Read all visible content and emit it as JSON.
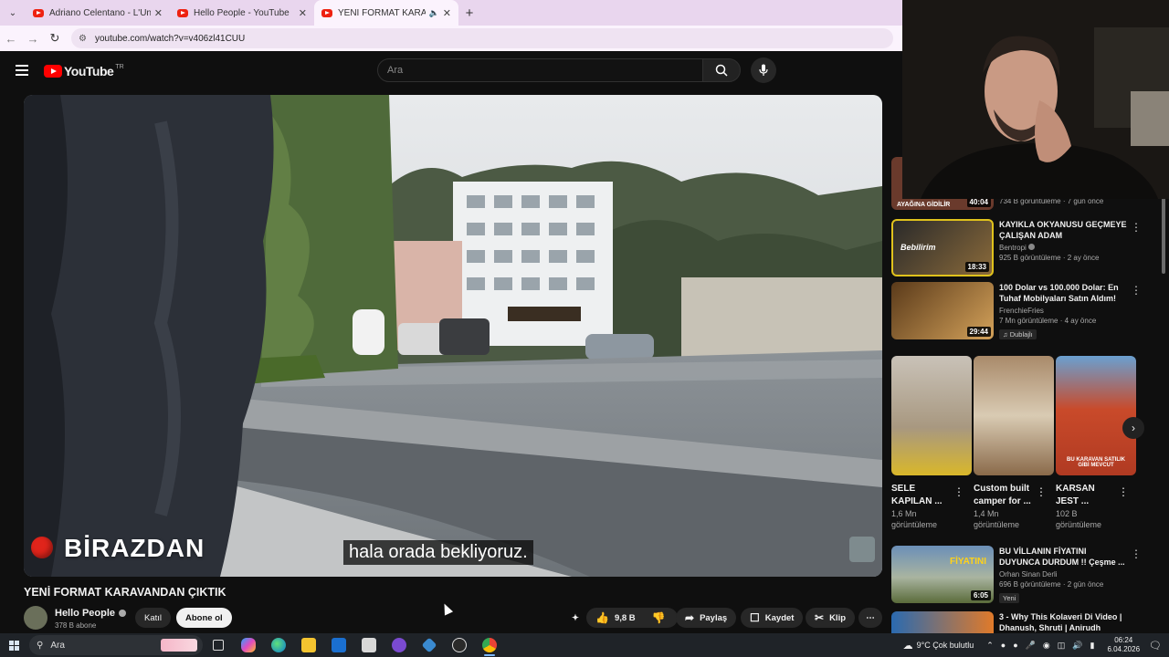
{
  "browser": {
    "tabs": [
      {
        "title": "Adriano Celentano - L'Unica Ch",
        "active": false
      },
      {
        "title": "Hello People - YouTube",
        "active": false
      },
      {
        "title": "YENİ FORMAT KARAVANDA",
        "active": true
      }
    ],
    "url": "youtube.com/watch?v=v406zl41CUU"
  },
  "yt": {
    "country": "TR",
    "logo": "YouTube",
    "search_placeholder": "Ara"
  },
  "video": {
    "overlay_text": "BİRAZDAN",
    "subtitle": "hala orada bekliyoruz.",
    "title": "YENİ FORMAT KARAVANDAN ÇIKTIK",
    "channel": "Hello People",
    "subscribers": "378 B abone",
    "join_label": "Katıl",
    "subscribe_label": "Abone ol",
    "likes": "9,8 B",
    "share_label": "Paylaş",
    "save_label": "Kaydet",
    "clip_label": "Klip"
  },
  "sidebar": {
    "top_partial": {
      "thumb_text": "AYAĞINA GİDİLİR",
      "duration": "40:04",
      "meta": "734 B görüntüleme · 7 gün önce"
    },
    "items": [
      {
        "title": "KAYIKLA OKYANUSU GEÇMEYE ÇALIŞAN ADAM",
        "channel": "Bentropi",
        "meta": "925 B görüntüleme · 2 ay önce",
        "duration": "18:33",
        "thumb_text": "Bebilirim"
      },
      {
        "title": "100 Dolar vs 100.000 Dolar: En Tuhaf Mobilyaları Satın Aldım!",
        "channel": "FrenchieFries",
        "meta": "7 Mn görüntüleme · 4 ay önce",
        "duration": "29:44",
        "badge": "Dublajlı"
      },
      {
        "title": "BU VİLLANIN FİYATINI DUYUNCA DURDUM !! Çeşme ...",
        "channel": "Orhan Sinan Derli",
        "meta": "696 B görüntüleme · 2 gün önce",
        "duration": "6:05",
        "badge": "Yeni",
        "thumb_text": "FİYATINI"
      },
      {
        "title": "3 - Why This Kolaveri Di Video | Dhanush, Shruti | Anirudh",
        "channel": "",
        "meta": "",
        "duration": ""
      }
    ],
    "shorts": [
      {
        "title": "SELE KAPILAN ...",
        "views": "1,6 Mn",
        "views_label": "görüntüleme"
      },
      {
        "title": "Custom built camper for ...",
        "views": "1,4 Mn",
        "views_label": "görüntüleme"
      },
      {
        "title": "KARSAN JEST ...",
        "views": "102 B",
        "views_label": "görüntüleme",
        "thumb_text": "BU KARAVAN SATILIK GİBİ MEVCUT"
      }
    ]
  },
  "taskbar": {
    "search_label": "Ara",
    "weather": "9°C  Çok bulutlu",
    "time": "06:24",
    "date": "6.04.2026"
  }
}
